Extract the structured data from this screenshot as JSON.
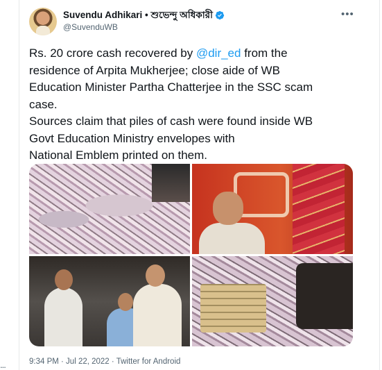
{
  "tweet": {
    "author": {
      "display_name": "Suvendu Adhikari • শুভেন্দু অধিকারী",
      "handle": "@SuvenduWB",
      "verified": true
    },
    "more_label": "•••",
    "text_lines": [
      {
        "before": "Rs. 20 crore cash recovered by ",
        "mention": "@dir_ed",
        "after": " from the"
      },
      {
        "text": "residence of Arpita Mukherjee; close aide of WB"
      },
      {
        "text": "Education Minister Partha Chatterjee in the SSC scam"
      },
      {
        "text": "case."
      },
      {
        "text": "Sources claim that piles of cash were found inside WB"
      },
      {
        "text": "Govt Education Ministry envelopes with"
      },
      {
        "text": "National Emblem printed on them."
      }
    ],
    "timestamp": "9:34 PM · Jul 22, 2022 · Twitter for Android",
    "media_count": 4
  },
  "colors": {
    "link": "#1d9bf0",
    "verified_badge": "#1d9bf0",
    "secondary_text": "#536471"
  },
  "icons": {
    "verified": "verified-badge-icon",
    "more": "more-options-icon"
  },
  "left_edge_text": "..."
}
